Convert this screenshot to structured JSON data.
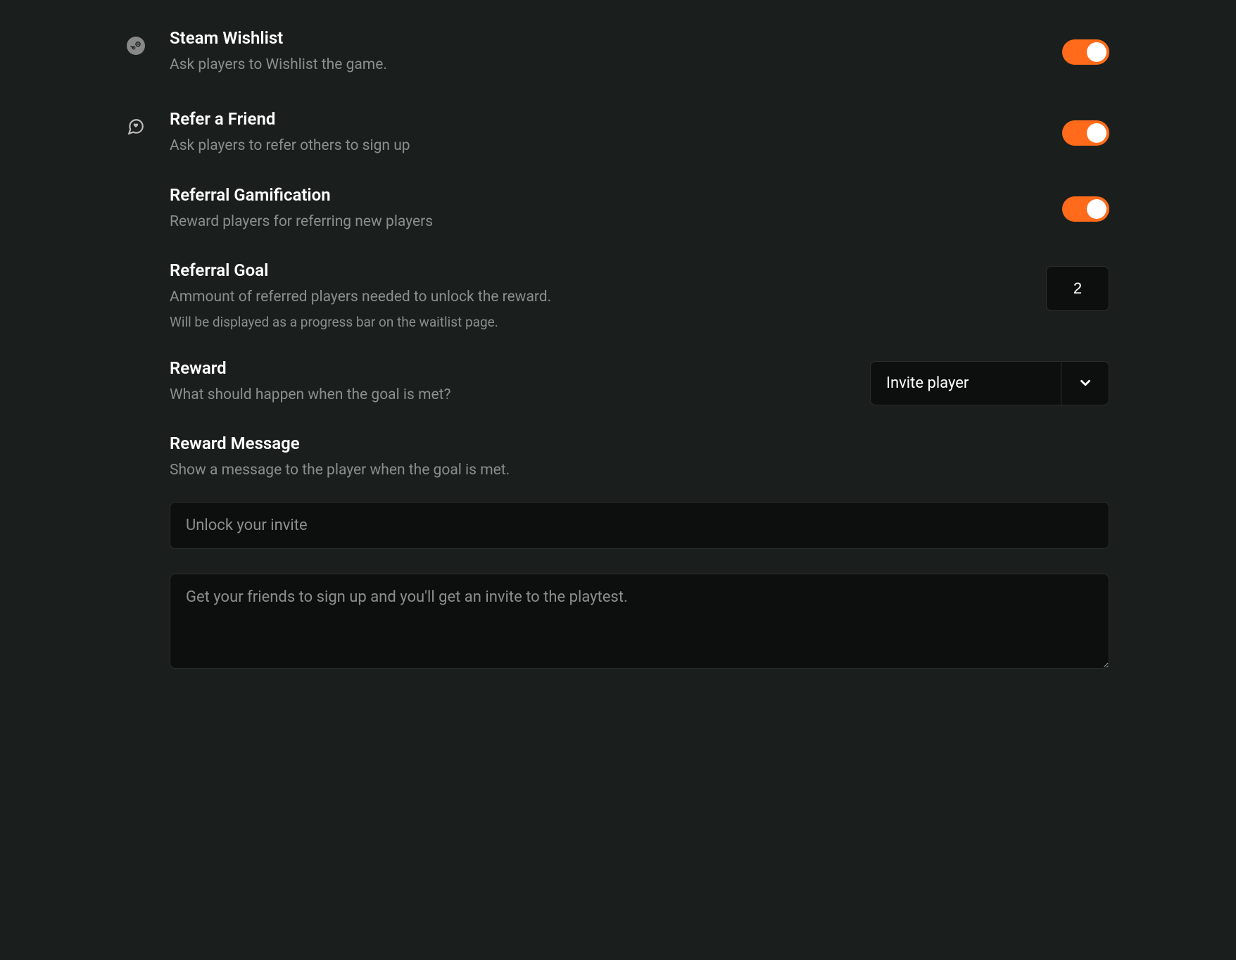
{
  "steam_wishlist": {
    "title": "Steam Wishlist",
    "description": "Ask players to Wishlist the game.",
    "enabled": true
  },
  "refer_friend": {
    "title": "Refer a Friend",
    "description": "Ask players to refer others to sign up",
    "enabled": true
  },
  "referral_gamification": {
    "title": "Referral Gamification",
    "description": "Reward players for referring new players",
    "enabled": true
  },
  "referral_goal": {
    "title": "Referral Goal",
    "description": "Ammount of referred players needed to unlock the reward.",
    "hint": "Will be displayed as a progress bar on the waitlist page.",
    "value": "2"
  },
  "reward": {
    "title": "Reward",
    "description": "What should happen when the goal is met?",
    "selected": "Invite player"
  },
  "reward_message": {
    "title": "Reward Message",
    "description": "Show a message to the player when the goal is met.",
    "input_value": "Unlock your invite",
    "textarea_value": "Get your friends to sign up and you'll get an invite to the playtest."
  }
}
